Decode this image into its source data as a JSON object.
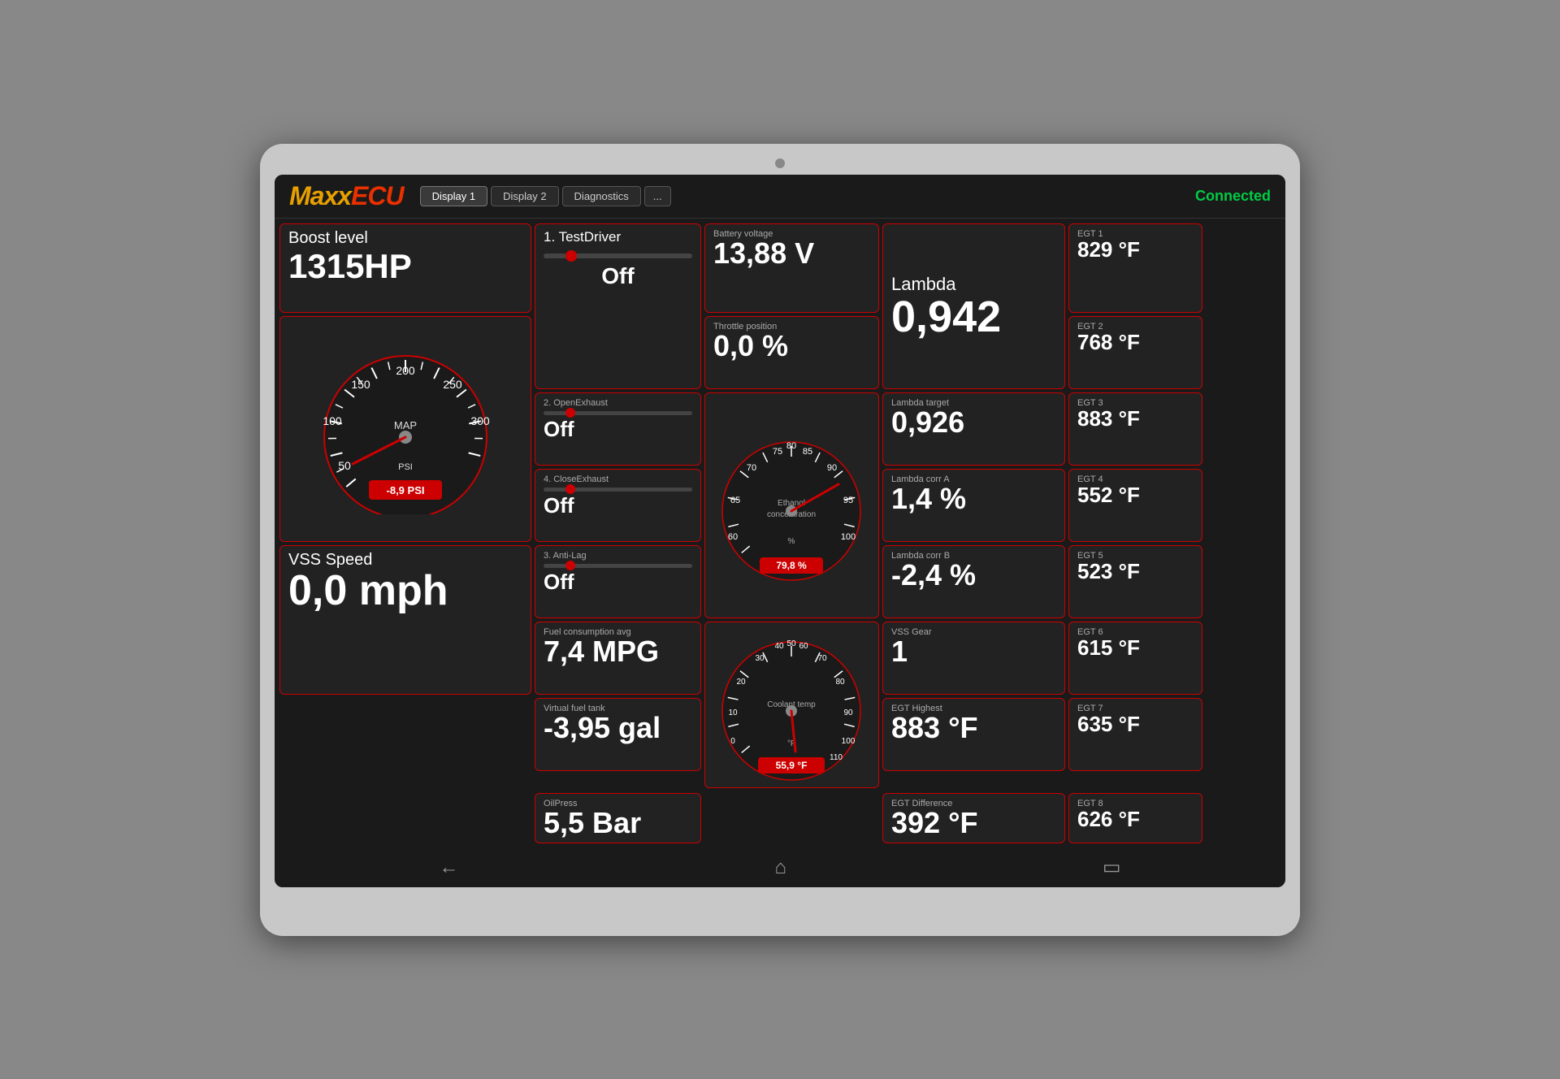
{
  "app": {
    "logo_maxx": "Maxx",
    "logo_ecu": "ECU",
    "connection_status": "Connected",
    "tabs": [
      {
        "label": "Display 1",
        "active": true
      },
      {
        "label": "Display 2",
        "active": false
      },
      {
        "label": "Diagnostics",
        "active": false
      },
      {
        "label": "...",
        "active": false
      }
    ]
  },
  "boost": {
    "label": "Boost level",
    "value": "1315HP"
  },
  "map_gauge": {
    "label": "MAP",
    "unit": "PSI",
    "reading": "-8,9 PSI",
    "min": 0,
    "max": 300
  },
  "vss": {
    "label": "VSS Speed",
    "value": "0,0 mph"
  },
  "testdriver": {
    "label": "1. TestDriver",
    "value": "Off"
  },
  "openexhaust": {
    "label": "2. OpenExhaust",
    "value": "Off"
  },
  "closeexhaust": {
    "label": "4. CloseExhaust",
    "value": "Off"
  },
  "antilag": {
    "label": "3. Anti-Lag",
    "value": "Off"
  },
  "fuel_consumption": {
    "label": "Fuel consumption avg",
    "value": "7,4 MPG"
  },
  "fuel_tank": {
    "label": "Virtual fuel tank",
    "value": "-3,95 gal"
  },
  "oil_press": {
    "label": "OilPress",
    "value": "5,5 Bar"
  },
  "battery": {
    "label": "Battery voltage",
    "value": "13,88 V"
  },
  "throttle": {
    "label": "Throttle position",
    "value": "0,0 %"
  },
  "ethanol": {
    "label": "Ethanol concentration",
    "unit": "%",
    "reading": "79,8 %",
    "value": 79.8
  },
  "coolant": {
    "label": "Coolant temp",
    "unit": "°F",
    "reading": "55,9 °F",
    "value": 55.9
  },
  "lambda": {
    "label": "Lambda",
    "value": "0,942"
  },
  "lambda_target": {
    "label": "Lambda target",
    "value": "0,926"
  },
  "lambda_corr_a": {
    "label": "Lambda corr A",
    "value": "1,4 %"
  },
  "lambda_corr_b": {
    "label": "Lambda corr B",
    "value": "-2,4 %"
  },
  "vss_gear": {
    "label": "VSS Gear",
    "value": "1"
  },
  "egt_highest": {
    "label": "EGT Highest",
    "value": "883 °F"
  },
  "egt_difference": {
    "label": "EGT Difference",
    "value": "392 °F"
  },
  "egt": [
    {
      "label": "EGT 1",
      "value": "829 °F"
    },
    {
      "label": "EGT 2",
      "value": "768 °F"
    },
    {
      "label": "EGT 3",
      "value": "883 °F"
    },
    {
      "label": "EGT 4",
      "value": "552 °F"
    },
    {
      "label": "EGT 5",
      "value": "523 °F"
    },
    {
      "label": "EGT 6",
      "value": "615 °F"
    },
    {
      "label": "EGT 7",
      "value": "635 °F"
    },
    {
      "label": "EGT 8",
      "value": "626 °F"
    }
  ],
  "nav": {
    "back": "←",
    "home": "⌂",
    "recent": "▭"
  }
}
